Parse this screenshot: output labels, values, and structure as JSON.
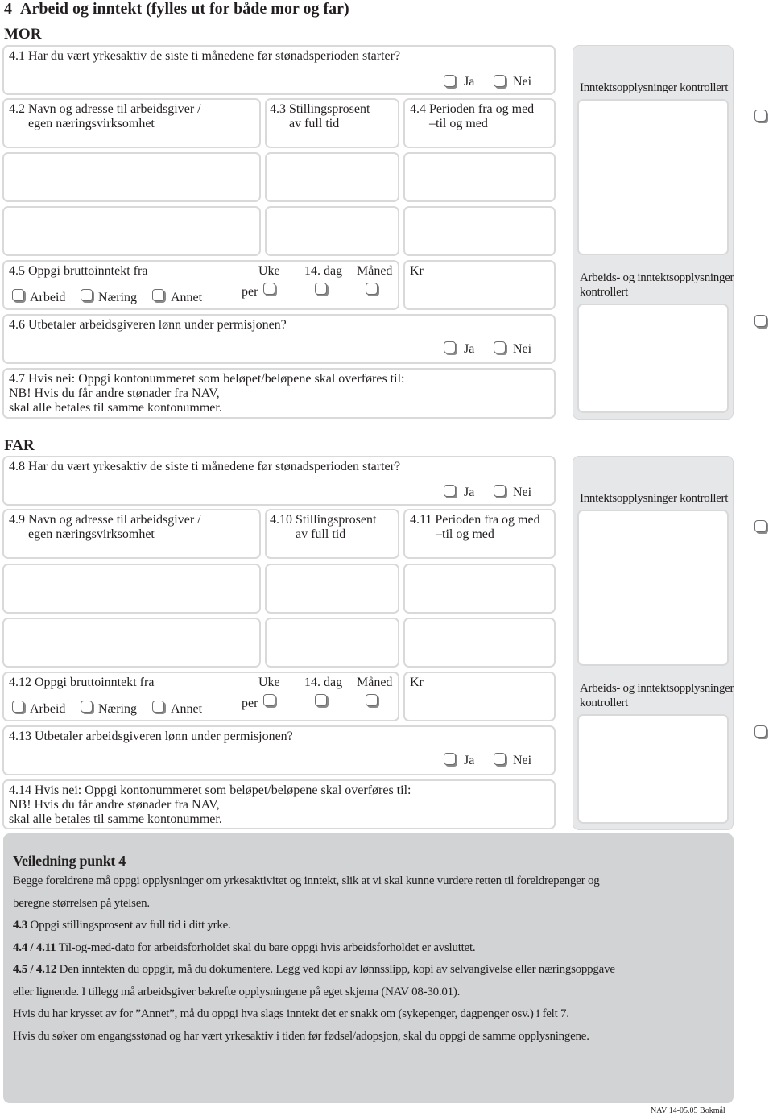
{
  "section": {
    "number": "4",
    "title": "Arbeid og inntekt (fylles ut for både mor og far)"
  },
  "mor": {
    "heading": "MOR",
    "q_employed": {
      "label": "4.1 Har du vært yrkesaktiv de siste ti månedene før stønadsperioden starter?",
      "yes": "Ja",
      "no": "Nei"
    },
    "employer_label": "4.2 Navn og adresse til arbeidsgiver /\n      egen næringsvirksomhet",
    "percent_label": "4.3 Stillingsprosent\n      av full tid",
    "period_label": "4.4 Perioden fra og med\n      –til og med",
    "income": {
      "label": "4.5 Oppgi bruttoinntekt fra",
      "sources": [
        "Arbeid",
        "Næring",
        "Annet"
      ],
      "per_label": "per",
      "periods": [
        "Uke",
        "14. dag",
        "Måned"
      ],
      "amount_label": "Kr"
    },
    "q_salary": {
      "label": "4.6 Utbetaler arbeidsgiveren lønn under permisjonen?",
      "yes": "Ja",
      "no": "Nei"
    },
    "account_label": "4.7 Hvis nei: Oppgi kontonummeret som beløpet/beløpene skal overføres til:\nNB! Hvis du får andre stønader fra NAV,\nskal alle betales til samme kontonummer.",
    "control": {
      "income_checked": "Inntektsopplysninger kontrollert",
      "work_income_checked": "Arbeids- og inntektsopplysninger\nkontrollert"
    }
  },
  "far": {
    "heading": "FAR",
    "q_employed": {
      "label": "4.8 Har du vært yrkesaktiv de siste ti månedene før stønadsperioden starter?",
      "yes": "Ja",
      "no": "Nei"
    },
    "employer_label": "4.9 Navn og adresse til arbeidsgiver /\n      egen næringsvirksomhet",
    "percent_label": "4.10 Stillingsprosent\n        av full tid",
    "period_label": "4.11 Perioden fra og med\n        –til og med",
    "income": {
      "label": "4.12 Oppgi bruttoinntekt fra",
      "sources": [
        "Arbeid",
        "Næring",
        "Annet"
      ],
      "per_label": "per",
      "periods": [
        "Uke",
        "14. dag",
        "Måned"
      ],
      "amount_label": "Kr"
    },
    "q_salary": {
      "label": "4.13 Utbetaler arbeidsgiveren lønn under permisjonen?",
      "yes": "Ja",
      "no": "Nei"
    },
    "account_label": "4.14 Hvis nei: Oppgi kontonummeret som beløpet/beløpene skal overføres til:\nNB! Hvis du får andre stønader fra NAV,\nskal alle betales til samme kontonummer.",
    "control": {
      "income_checked": "Inntektsopplysninger kontrollert",
      "work_income_checked": "Arbeids- og inntektsopplysninger\nkontrollert"
    }
  },
  "guidance": {
    "title": "Veiledning punkt 4",
    "lines": [
      {
        "bold": "",
        "text": "Begge foreldrene må oppgi opplysninger om yrkesaktivitet og inntekt, slik at vi skal kunne vurdere retten til foreldrepenger og"
      },
      {
        "bold": "",
        "text": "beregne størrelsen på ytelsen."
      },
      {
        "bold": "4.3",
        "text": " Oppgi stillingsprosent av full tid i ditt yrke."
      },
      {
        "bold": "4.4 / 4.11",
        "text": " Til-og-med-dato for arbeidsforholdet skal du bare oppgi hvis arbeidsforholdet er avsluttet."
      },
      {
        "bold": "4.5 / 4.12",
        "text": " Den inntekten du oppgir, må du dokumentere. Legg ved kopi av lønnsslipp, kopi av selvangivelse eller næringsoppgave"
      },
      {
        "bold": "",
        "text": "eller lignende. I tillegg må arbeidsgiver bekrefte opplysningene på eget skjema (NAV 08-30.01)."
      },
      {
        "bold": "",
        "text": "Hvis du har krysset av for ”Annet”, må du oppgi hva slags inntekt det er snakk om (sykepenger, dagpenger osv.) i felt 7."
      },
      {
        "bold": "",
        "text": "Hvis du søker om engangsstønad og har vært yrkesaktiv i tiden før fødsel/adopsjon, skal du oppgi de samme opplysningene."
      }
    ]
  },
  "footer": {
    "form_id": "NAV 14-05.05 Bokmål"
  }
}
